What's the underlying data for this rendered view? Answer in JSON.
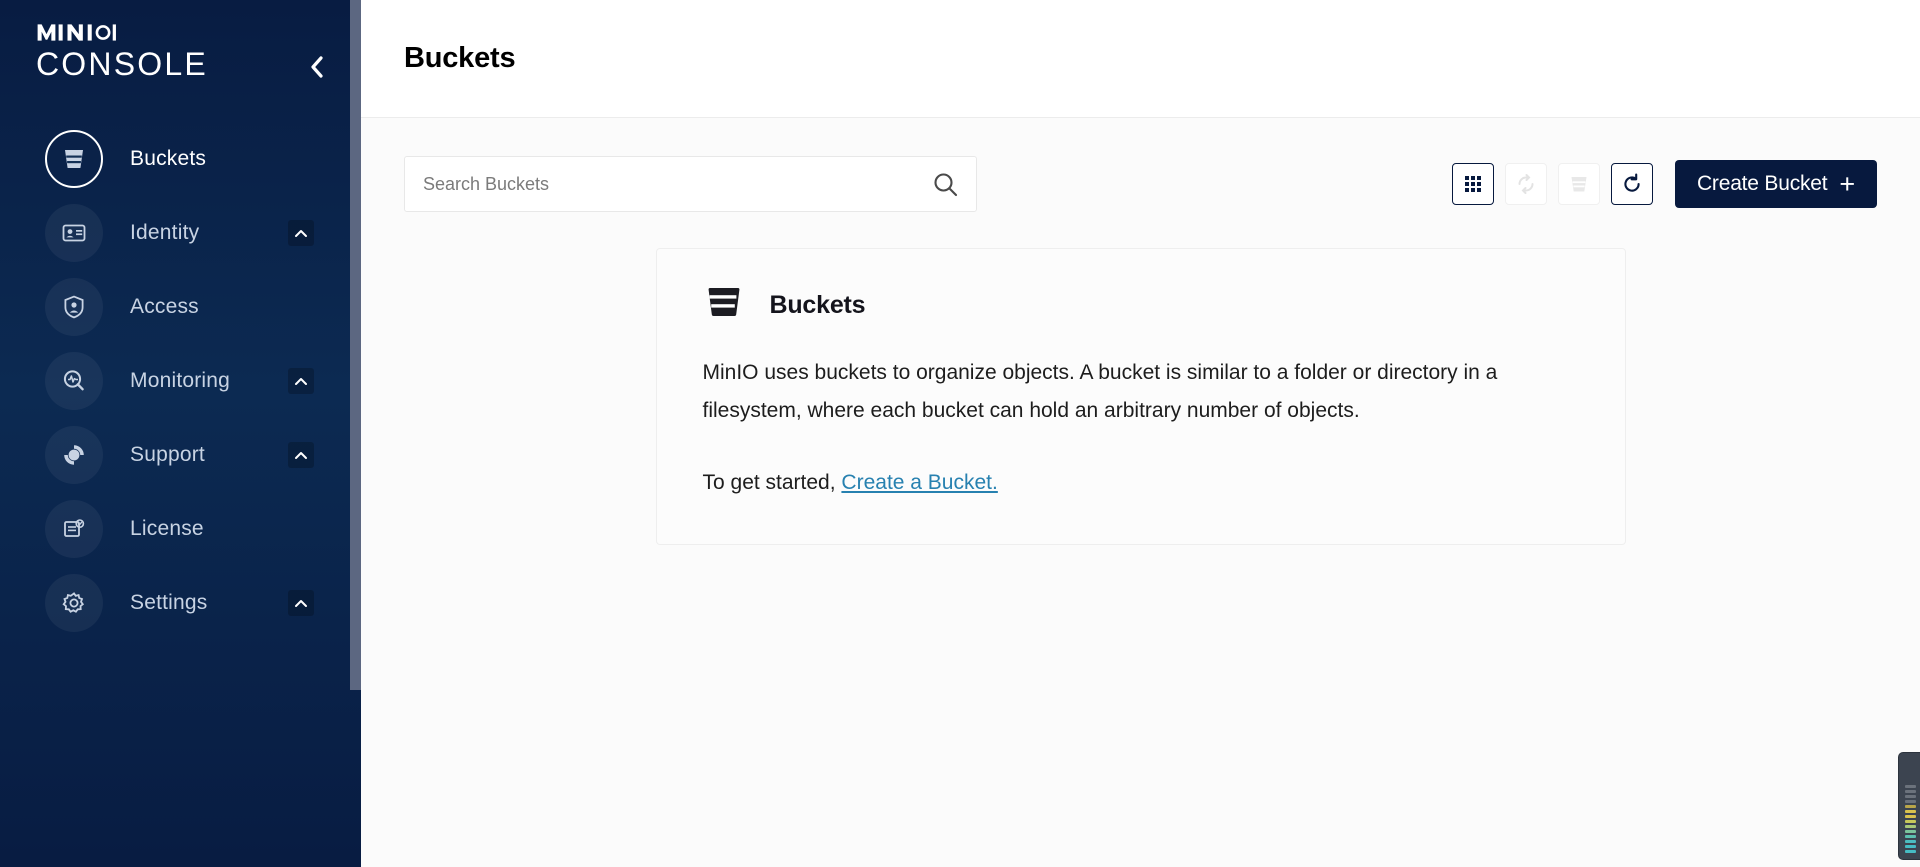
{
  "brand": {
    "logo_top": "MINIO",
    "logo_bottom": "CONSOLE",
    "collapse_icon": "chevron-left-icon"
  },
  "sidebar": {
    "items": [
      {
        "label": "Buckets",
        "icon": "bucket-icon",
        "active": true,
        "expandable": false
      },
      {
        "label": "Identity",
        "icon": "id-card-icon",
        "active": false,
        "expandable": true
      },
      {
        "label": "Access",
        "icon": "lock-user-icon",
        "active": false,
        "expandable": false
      },
      {
        "label": "Monitoring",
        "icon": "monitoring-icon",
        "active": false,
        "expandable": true
      },
      {
        "label": "Support",
        "icon": "support-icon",
        "active": false,
        "expandable": true
      },
      {
        "label": "License",
        "icon": "license-icon",
        "active": false,
        "expandable": false
      },
      {
        "label": "Settings",
        "icon": "gear-icon",
        "active": false,
        "expandable": true
      }
    ],
    "chevron_icon": "chevron-up-icon"
  },
  "header": {
    "title": "Buckets"
  },
  "search": {
    "placeholder": "Search Buckets",
    "value": "",
    "icon": "search-icon"
  },
  "toolbar": {
    "buttons": [
      {
        "name": "tiles-view-button",
        "icon": "grid-icon",
        "enabled": true
      },
      {
        "name": "replication-button",
        "icon": "sync-icon",
        "enabled": false
      },
      {
        "name": "delete-selected-button",
        "icon": "bucket-icon",
        "enabled": false
      },
      {
        "name": "refresh-button",
        "icon": "refresh-icon",
        "enabled": true
      }
    ],
    "create_label": "Create Bucket",
    "create_plus": "+"
  },
  "info_card": {
    "icon": "bucket-icon",
    "title": "Buckets",
    "paragraph1": "MinIO uses buckets to organize objects. A bucket is similar to a folder or directory in a filesystem, where each bucket can hold an arbitrary number of objects.",
    "cta_prefix": "To get started, ",
    "cta_link": "Create a Bucket."
  },
  "colors": {
    "sidebar_bg": "#081c42",
    "accent_dark": "#07193e",
    "link": "#2781b0",
    "sidebar_text": "#c8d3e3",
    "scrollbar_thumb": "#5c6781"
  }
}
